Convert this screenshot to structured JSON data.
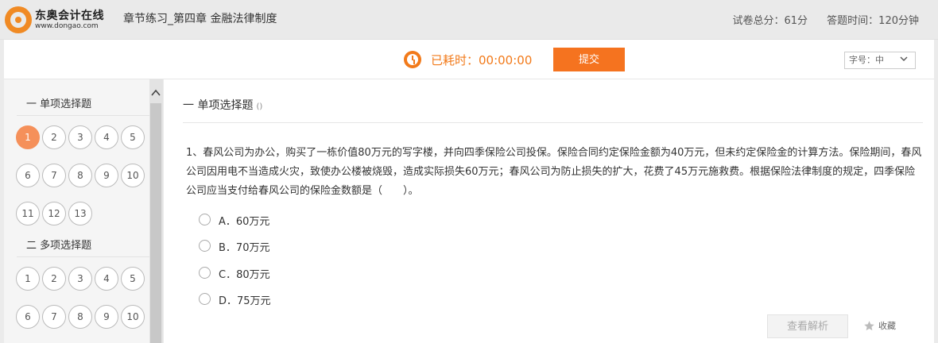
{
  "header": {
    "logo_name": "东奥会计在线",
    "logo_url": "www.dongao.com",
    "paper_title": "章节练习_第四章 金融法律制度",
    "total_score": "试卷总分：61分",
    "answer_time": "答题时间：120分钟"
  },
  "toolbar": {
    "timer": "已耗时：00:00:00",
    "submit_label": "提交",
    "font_size": "字号：中"
  },
  "sidebar": {
    "sections": [
      {
        "title": "一 单项选择题",
        "numbers": [
          "1",
          "2",
          "3",
          "4",
          "5",
          "6",
          "7",
          "8",
          "9",
          "10",
          "11",
          "12",
          "13"
        ],
        "active": "1"
      },
      {
        "title": "二 多项选择题",
        "numbers": [
          "1",
          "2",
          "3",
          "4",
          "5",
          "6",
          "7",
          "8",
          "9",
          "10"
        ]
      }
    ]
  },
  "main": {
    "section_title": "一 单项选择题",
    "section_note": "()",
    "question": "1、春风公司为办公，购买了一栋价值80万元的写字楼，并向四季保险公司投保。保险合同约定保险金额为40万元，但未约定保险金的计算方法。保险期间，春风公司因用电不当造成火灾，致使办公楼被烧毁，造成实际损失60万元；春风公司为防止损失的扩大，花费了45万元施救费。根据保险法律制度的规定，四季保险公司应当支付给春风公司的保险金数额是（　　）。",
    "options": [
      "A．60万元",
      "B．70万元",
      "C．80万元",
      "D．75万元"
    ],
    "analysis_label": "查看解析",
    "favorite_label": "收藏"
  },
  "colors": {
    "accent": "#f5731f",
    "active_number": "#f5905a"
  },
  "icons": {
    "clock": "clock-icon",
    "chevron": "chevron-down-icon",
    "star": "star-icon",
    "scroll_up": "scroll-up-icon"
  }
}
